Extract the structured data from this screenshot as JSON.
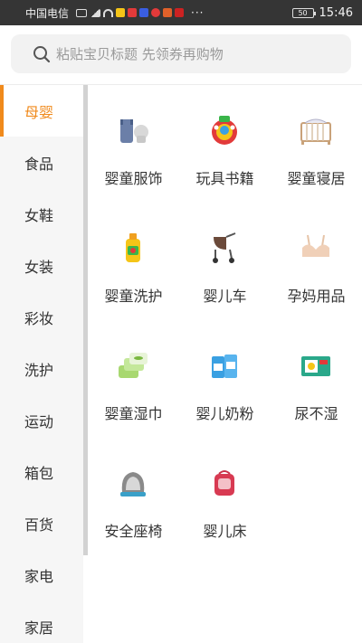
{
  "status_bar": {
    "carrier": "中国电信",
    "battery": "50",
    "time": "15:46",
    "dots": "···"
  },
  "search": {
    "placeholder": "粘贴宝贝标题 先领券再购物"
  },
  "sidebar": {
    "items": [
      {
        "label": "母婴",
        "active": true
      },
      {
        "label": "食品"
      },
      {
        "label": "女鞋"
      },
      {
        "label": "女装"
      },
      {
        "label": "彩妆"
      },
      {
        "label": "洗护"
      },
      {
        "label": "运动"
      },
      {
        "label": "箱包"
      },
      {
        "label": "百货"
      },
      {
        "label": "家电"
      },
      {
        "label": "家居"
      }
    ]
  },
  "categories": [
    {
      "label": "婴童服饰",
      "icon": "baby-clothes-icon"
    },
    {
      "label": "玩具书籍",
      "icon": "toy-icon"
    },
    {
      "label": "婴童寝居",
      "icon": "crib-icon"
    },
    {
      "label": "婴童洗护",
      "icon": "baby-wash-icon"
    },
    {
      "label": "婴儿车",
      "icon": "stroller-icon"
    },
    {
      "label": "孕妈用品",
      "icon": "maternity-bra-icon"
    },
    {
      "label": "婴童湿巾",
      "icon": "wet-wipes-icon"
    },
    {
      "label": "婴儿奶粉",
      "icon": "milk-powder-icon"
    },
    {
      "label": "尿不湿",
      "icon": "diaper-icon"
    },
    {
      "label": "安全座椅",
      "icon": "car-seat-icon"
    },
    {
      "label": "婴儿床",
      "icon": "baby-bed-icon"
    }
  ],
  "colors": {
    "accent": "#f08a1c",
    "status_bar": "#353535",
    "sidebar_bg": "#f6f6f6"
  }
}
